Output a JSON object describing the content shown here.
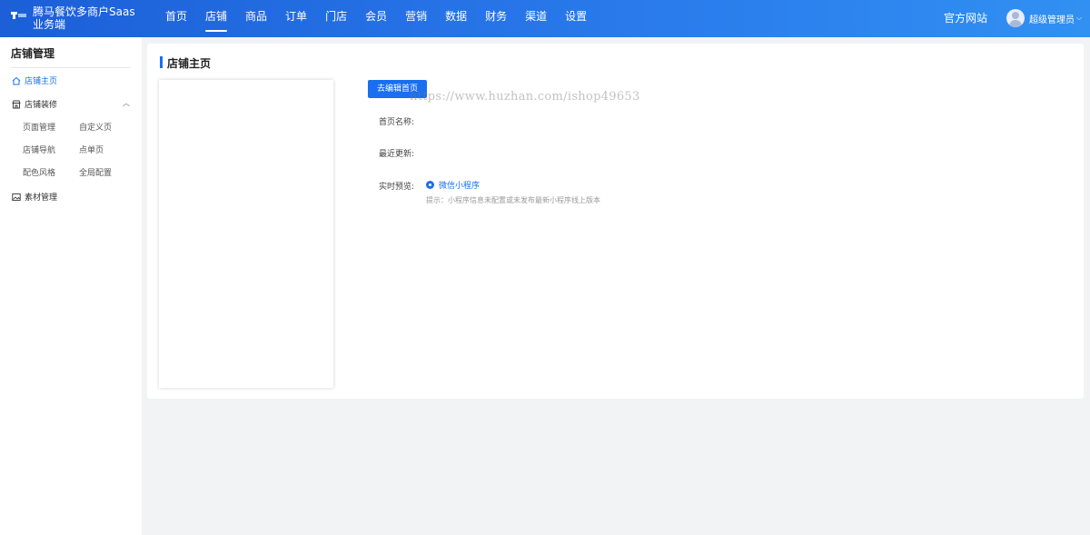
{
  "app": {
    "title": "腾马餐饮多商户Saas业务端"
  },
  "nav": {
    "items": [
      {
        "label": "首页",
        "active": false
      },
      {
        "label": "店铺",
        "active": true
      },
      {
        "label": "商品",
        "active": false
      },
      {
        "label": "订单",
        "active": false
      },
      {
        "label": "门店",
        "active": false
      },
      {
        "label": "会员",
        "active": false
      },
      {
        "label": "营销",
        "active": false
      },
      {
        "label": "数据",
        "active": false
      },
      {
        "label": "财务",
        "active": false
      },
      {
        "label": "渠道",
        "active": false
      },
      {
        "label": "设置",
        "active": false
      }
    ],
    "official_site": "官方网站",
    "user_name": "超级管理员",
    "user_caret": "⌵"
  },
  "sidebar": {
    "title": "店铺管理",
    "items": [
      {
        "label": "店铺主页",
        "icon": "home-icon",
        "active": true
      },
      {
        "label": "店铺装修",
        "icon": "shop-icon",
        "active": false
      },
      {
        "label": "素材管理",
        "icon": "image-icon",
        "active": false
      }
    ],
    "collapse_glyph": "︿",
    "sub_items": [
      {
        "label": "页面管理"
      },
      {
        "label": "自定义页"
      },
      {
        "label": "店铺导航"
      },
      {
        "label": "点单页"
      },
      {
        "label": "配色风格"
      },
      {
        "label": "全局配置"
      }
    ]
  },
  "main": {
    "page_title": "店铺主页",
    "edit_button": "去编辑首页",
    "watermark": "https://www.huzhan.com/ishop49653",
    "fields": {
      "name_label": "首页名称:",
      "updated_label": "最近更新:",
      "preview_label": "实时预览:"
    },
    "preview_option": "微信小程序",
    "hint": "提示：小程序信息未配置或未发布最新小程序线上版本"
  },
  "colors": {
    "accent": "#1a6ff0",
    "topbar_start": "#1c5fd8",
    "topbar_end": "#3190f2"
  }
}
